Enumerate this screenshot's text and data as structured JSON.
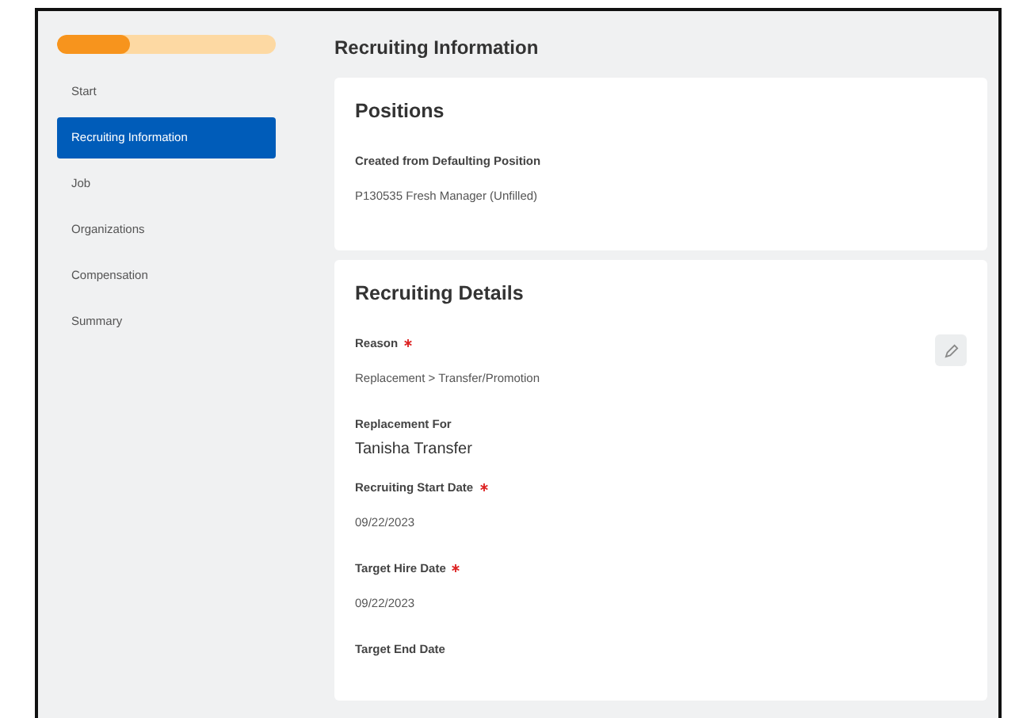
{
  "progress": {
    "level": 0.33
  },
  "sidebar": {
    "items": [
      {
        "label": "Start",
        "selected": false
      },
      {
        "label": "Recruiting Information",
        "selected": true
      },
      {
        "label": "Job",
        "selected": false
      },
      {
        "label": "Organizations",
        "selected": false
      },
      {
        "label": "Compensation",
        "selected": false
      },
      {
        "label": "Summary",
        "selected": false
      }
    ]
  },
  "page_title": "Recruiting Information",
  "cards": [
    {
      "title": "Positions",
      "editable": false,
      "fields": [
        {
          "label": "Created from Defaulting Position",
          "required": false,
          "kind": "plain",
          "value": "P130535 Fresh Manager (Unfilled)"
        }
      ]
    },
    {
      "title": "Recruiting Details",
      "editable": true,
      "fields": [
        {
          "label": "Reason",
          "required": true,
          "kind": "plain",
          "value": "Replacement > Transfer/Promotion"
        },
        {
          "label": "Replacement For",
          "required": false,
          "kind": "prominent",
          "value": "Tanisha Transfer"
        },
        {
          "label": "Recruiting Start Date",
          "required": true,
          "kind": "plain",
          "value": "09/22/2023"
        },
        {
          "label": "Target Hire Date",
          "required": true,
          "kind": "plain",
          "value": "09/22/2023"
        },
        {
          "label": "Target End Date",
          "required": false
        }
      ]
    }
  ]
}
